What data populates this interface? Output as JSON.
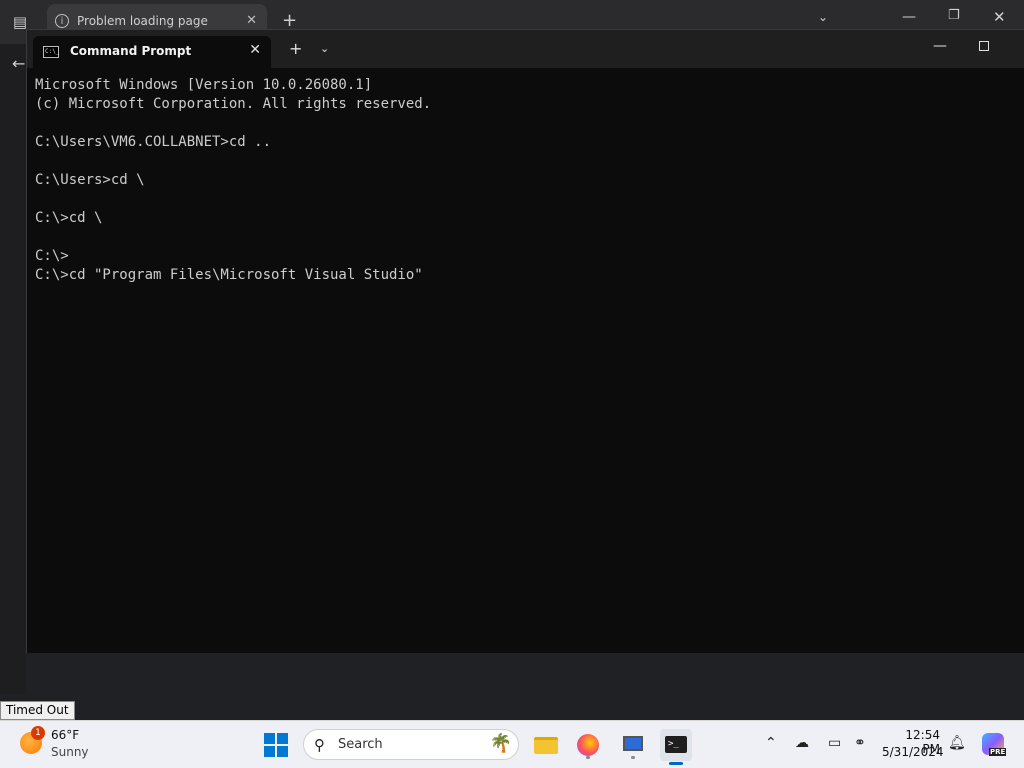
{
  "background_browser": {
    "tab_title": "Problem loading page"
  },
  "terminal": {
    "tab_title": "Command Prompt",
    "cmd_icon_text": "C:\\_",
    "lines": [
      "Microsoft Windows [Version 10.0.26080.1]",
      "(c) Microsoft Corporation. All rights reserved.",
      "",
      "C:\\Users\\VM6.COLLABNET>cd ..",
      "",
      "C:\\Users>cd \\",
      "",
      "C:\\>cd \\",
      "",
      "C:\\>",
      "C:\\>cd \"Program Files\\Microsoft Visual Studio\""
    ]
  },
  "status_label": "Timed Out",
  "taskbar": {
    "weather": {
      "badge": "1",
      "temperature": "66°F",
      "condition": "Sunny"
    },
    "search_label": "Search",
    "clock": {
      "time": "12:54 PM",
      "date": "5/31/2024"
    },
    "copilot_badge": "PRE"
  },
  "icons": {
    "info": "info-icon",
    "terminal": "cmd-icon",
    "search": "search-icon"
  }
}
